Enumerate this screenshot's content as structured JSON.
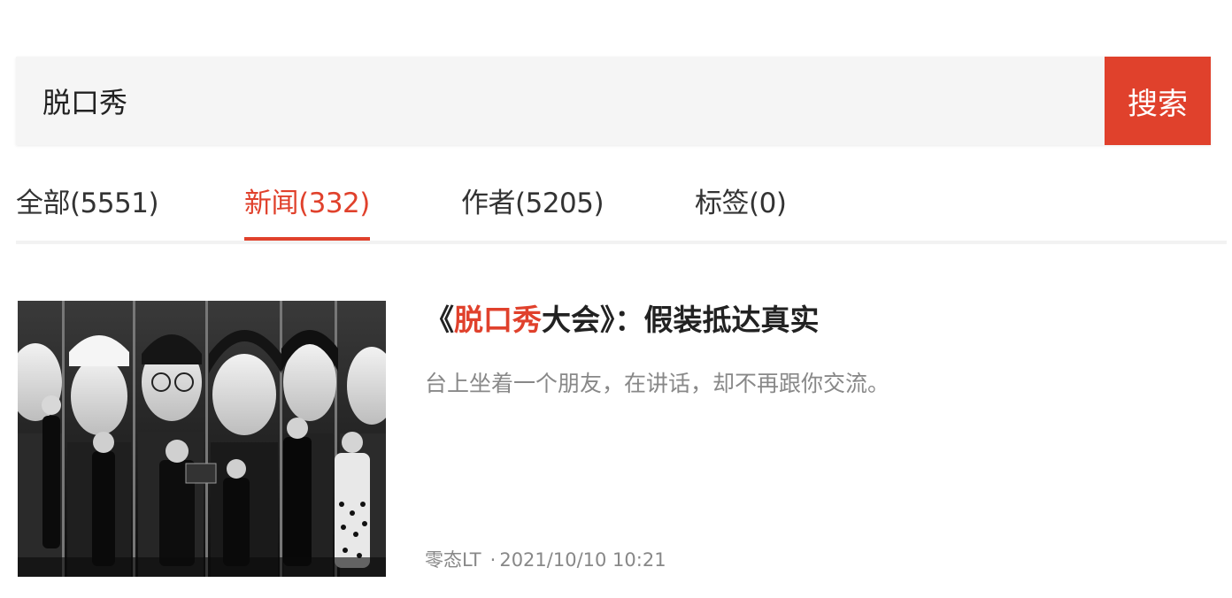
{
  "search": {
    "value": "脱口秀",
    "button_label": "搜索"
  },
  "tabs": [
    {
      "label": "全部(5551)",
      "active": false
    },
    {
      "label": "新闻(332)",
      "active": true
    },
    {
      "label": "作者(5205)",
      "active": false
    },
    {
      "label": "标签(0)",
      "active": false
    }
  ],
  "results": [
    {
      "title_prefix": "《",
      "title_highlight": "脱口秀",
      "title_suffix": "大会》：假装抵达真实",
      "summary": "台上坐着一个朋友，在讲话，却不再跟你交流。",
      "author": "零态LT",
      "separator": "·",
      "datetime": "2021/10/10 10:21",
      "thumbnail": "stand-up-comedy-cast-photo"
    }
  ],
  "colors": {
    "accent": "#e0412c",
    "text": "#222222",
    "muted": "#888888",
    "input_bg": "#f5f5f5"
  }
}
